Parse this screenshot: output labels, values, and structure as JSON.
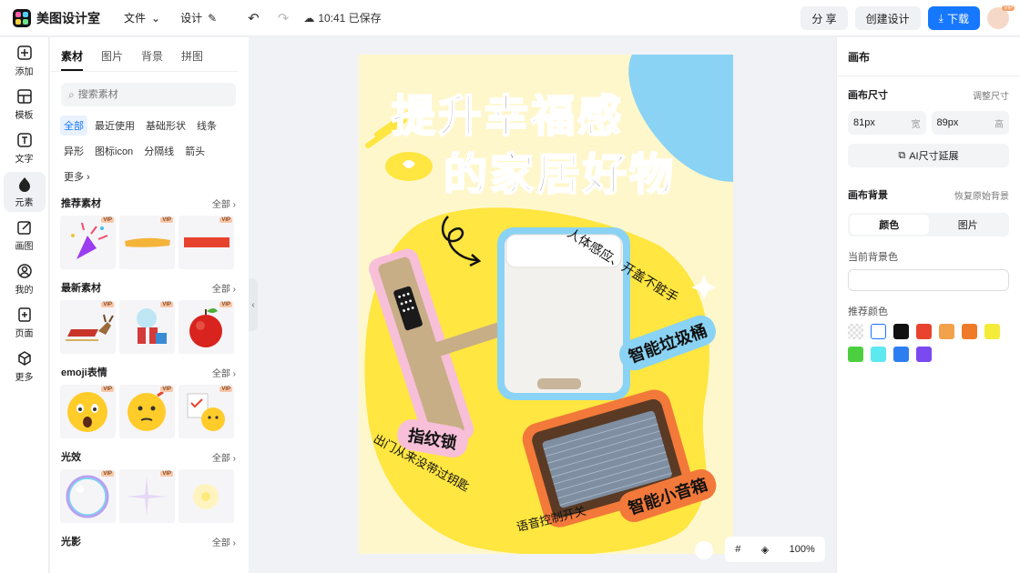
{
  "app": {
    "name": "美图设计室"
  },
  "topbar": {
    "file_label": "文件",
    "design_label": "设计",
    "saved_status": "10:41 已保存",
    "share_label": "分 享",
    "create_label": "创建设计",
    "download_label": "下载",
    "vip_badge": "VIP"
  },
  "rail": [
    {
      "label": "添加",
      "icon": "plus-square-icon"
    },
    {
      "label": "模板",
      "icon": "template-icon"
    },
    {
      "label": "文字",
      "icon": "text-icon"
    },
    {
      "label": "元素",
      "icon": "shapes-icon"
    },
    {
      "label": "画图",
      "icon": "draw-icon"
    },
    {
      "label": "我的",
      "icon": "user-icon"
    },
    {
      "label": "页面",
      "icon": "page-icon"
    },
    {
      "label": "更多",
      "icon": "cube-icon"
    }
  ],
  "panel": {
    "tabs": [
      "素材",
      "图片",
      "背景",
      "拼图"
    ],
    "search_placeholder": "搜索素材",
    "chips": [
      "全部",
      "最近使用",
      "基础形状",
      "线条",
      "异形",
      "图标icon",
      "分隔线",
      "箭头",
      "更多"
    ],
    "sections": [
      {
        "title": "推荐素材",
        "all": "全部"
      },
      {
        "title": "最新素材",
        "all": "全部"
      },
      {
        "title": "emoji表情",
        "all": "全部"
      },
      {
        "title": "光效",
        "all": "全部"
      },
      {
        "title": "光影",
        "all": "全部"
      }
    ],
    "vip_tag": "VIP"
  },
  "poster": {
    "title_line1": "提升幸福感",
    "title_line2": "的家居好物",
    "caption_trash": "人体感应、开盖不脏手",
    "label_trash": "智能垃圾桶",
    "label_lock": "指纹锁",
    "caption_lock": "出门从来没带过钥匙",
    "label_speaker": "智能小音箱",
    "caption_speaker": "语音控制开关"
  },
  "zoom": {
    "level": "100%"
  },
  "rpanel": {
    "title": "画布",
    "size_label": "画布尺寸",
    "adjust_size": "调整尺寸",
    "width_value": "81px",
    "width_unit": "宽",
    "height_value": "89px",
    "height_unit": "高",
    "ai_extend": "AI尺寸延展",
    "bg_label": "画布背景",
    "restore_bg": "恢复原始背景",
    "seg_color": "颜色",
    "seg_image": "图片",
    "current_bg": "当前背景色",
    "recommended": "推荐颜色",
    "swatches": [
      "transparent",
      "#ffffff",
      "#111111",
      "#e8432e",
      "#f2a24a",
      "#ee7a2a",
      "#f5ec3a",
      "#4ccf3f",
      "#5ee8f0",
      "#2d7ff0",
      "#7a4af0"
    ]
  }
}
